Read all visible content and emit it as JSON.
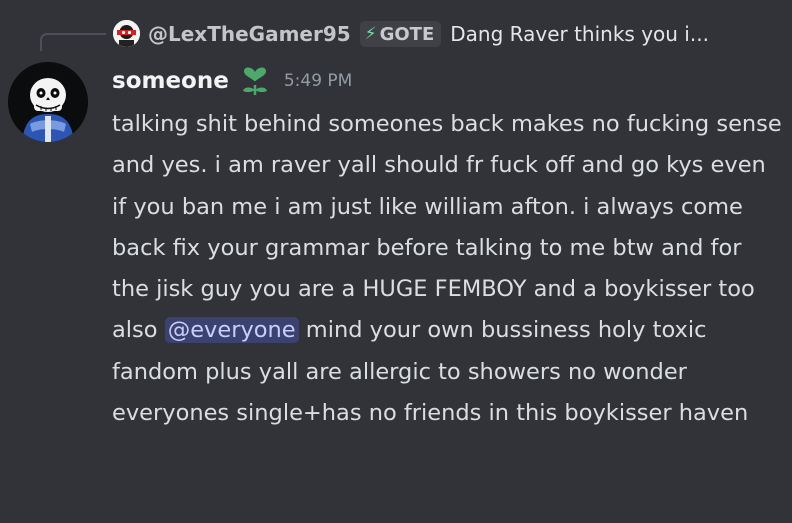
{
  "reply": {
    "author": "@LexTheGamer95",
    "tag_label": "GOTE",
    "tag_icon": "lightning-bolt-icon",
    "excerpt": "Dang Raver thinks you i..."
  },
  "message": {
    "author": "someone",
    "role_icon": "heart-sprout-icon",
    "role_icon_color": "#4fa86b",
    "timestamp": "5:49 PM",
    "text_before": "talking shit behind someones back makes no fucking sense and yes. i am raver yall should fr fuck off and go kys even if you ban me i am just like william afton. i always come back fix your grammar before talking to me btw and for the jisk guy you are a HUGE FEMBOY and a boykisser too also",
    "mention": "@everyone",
    "text_after": "mind your own bussiness holy toxic fandom plus yall are allergic to showers no wonder everyones single+has no friends in this boykisser haven"
  },
  "colors": {
    "background": "#313338",
    "mention_bg": "#3c4270",
    "mention_text": "#c9cdfb",
    "tag_bolt": "#72d5a9"
  }
}
